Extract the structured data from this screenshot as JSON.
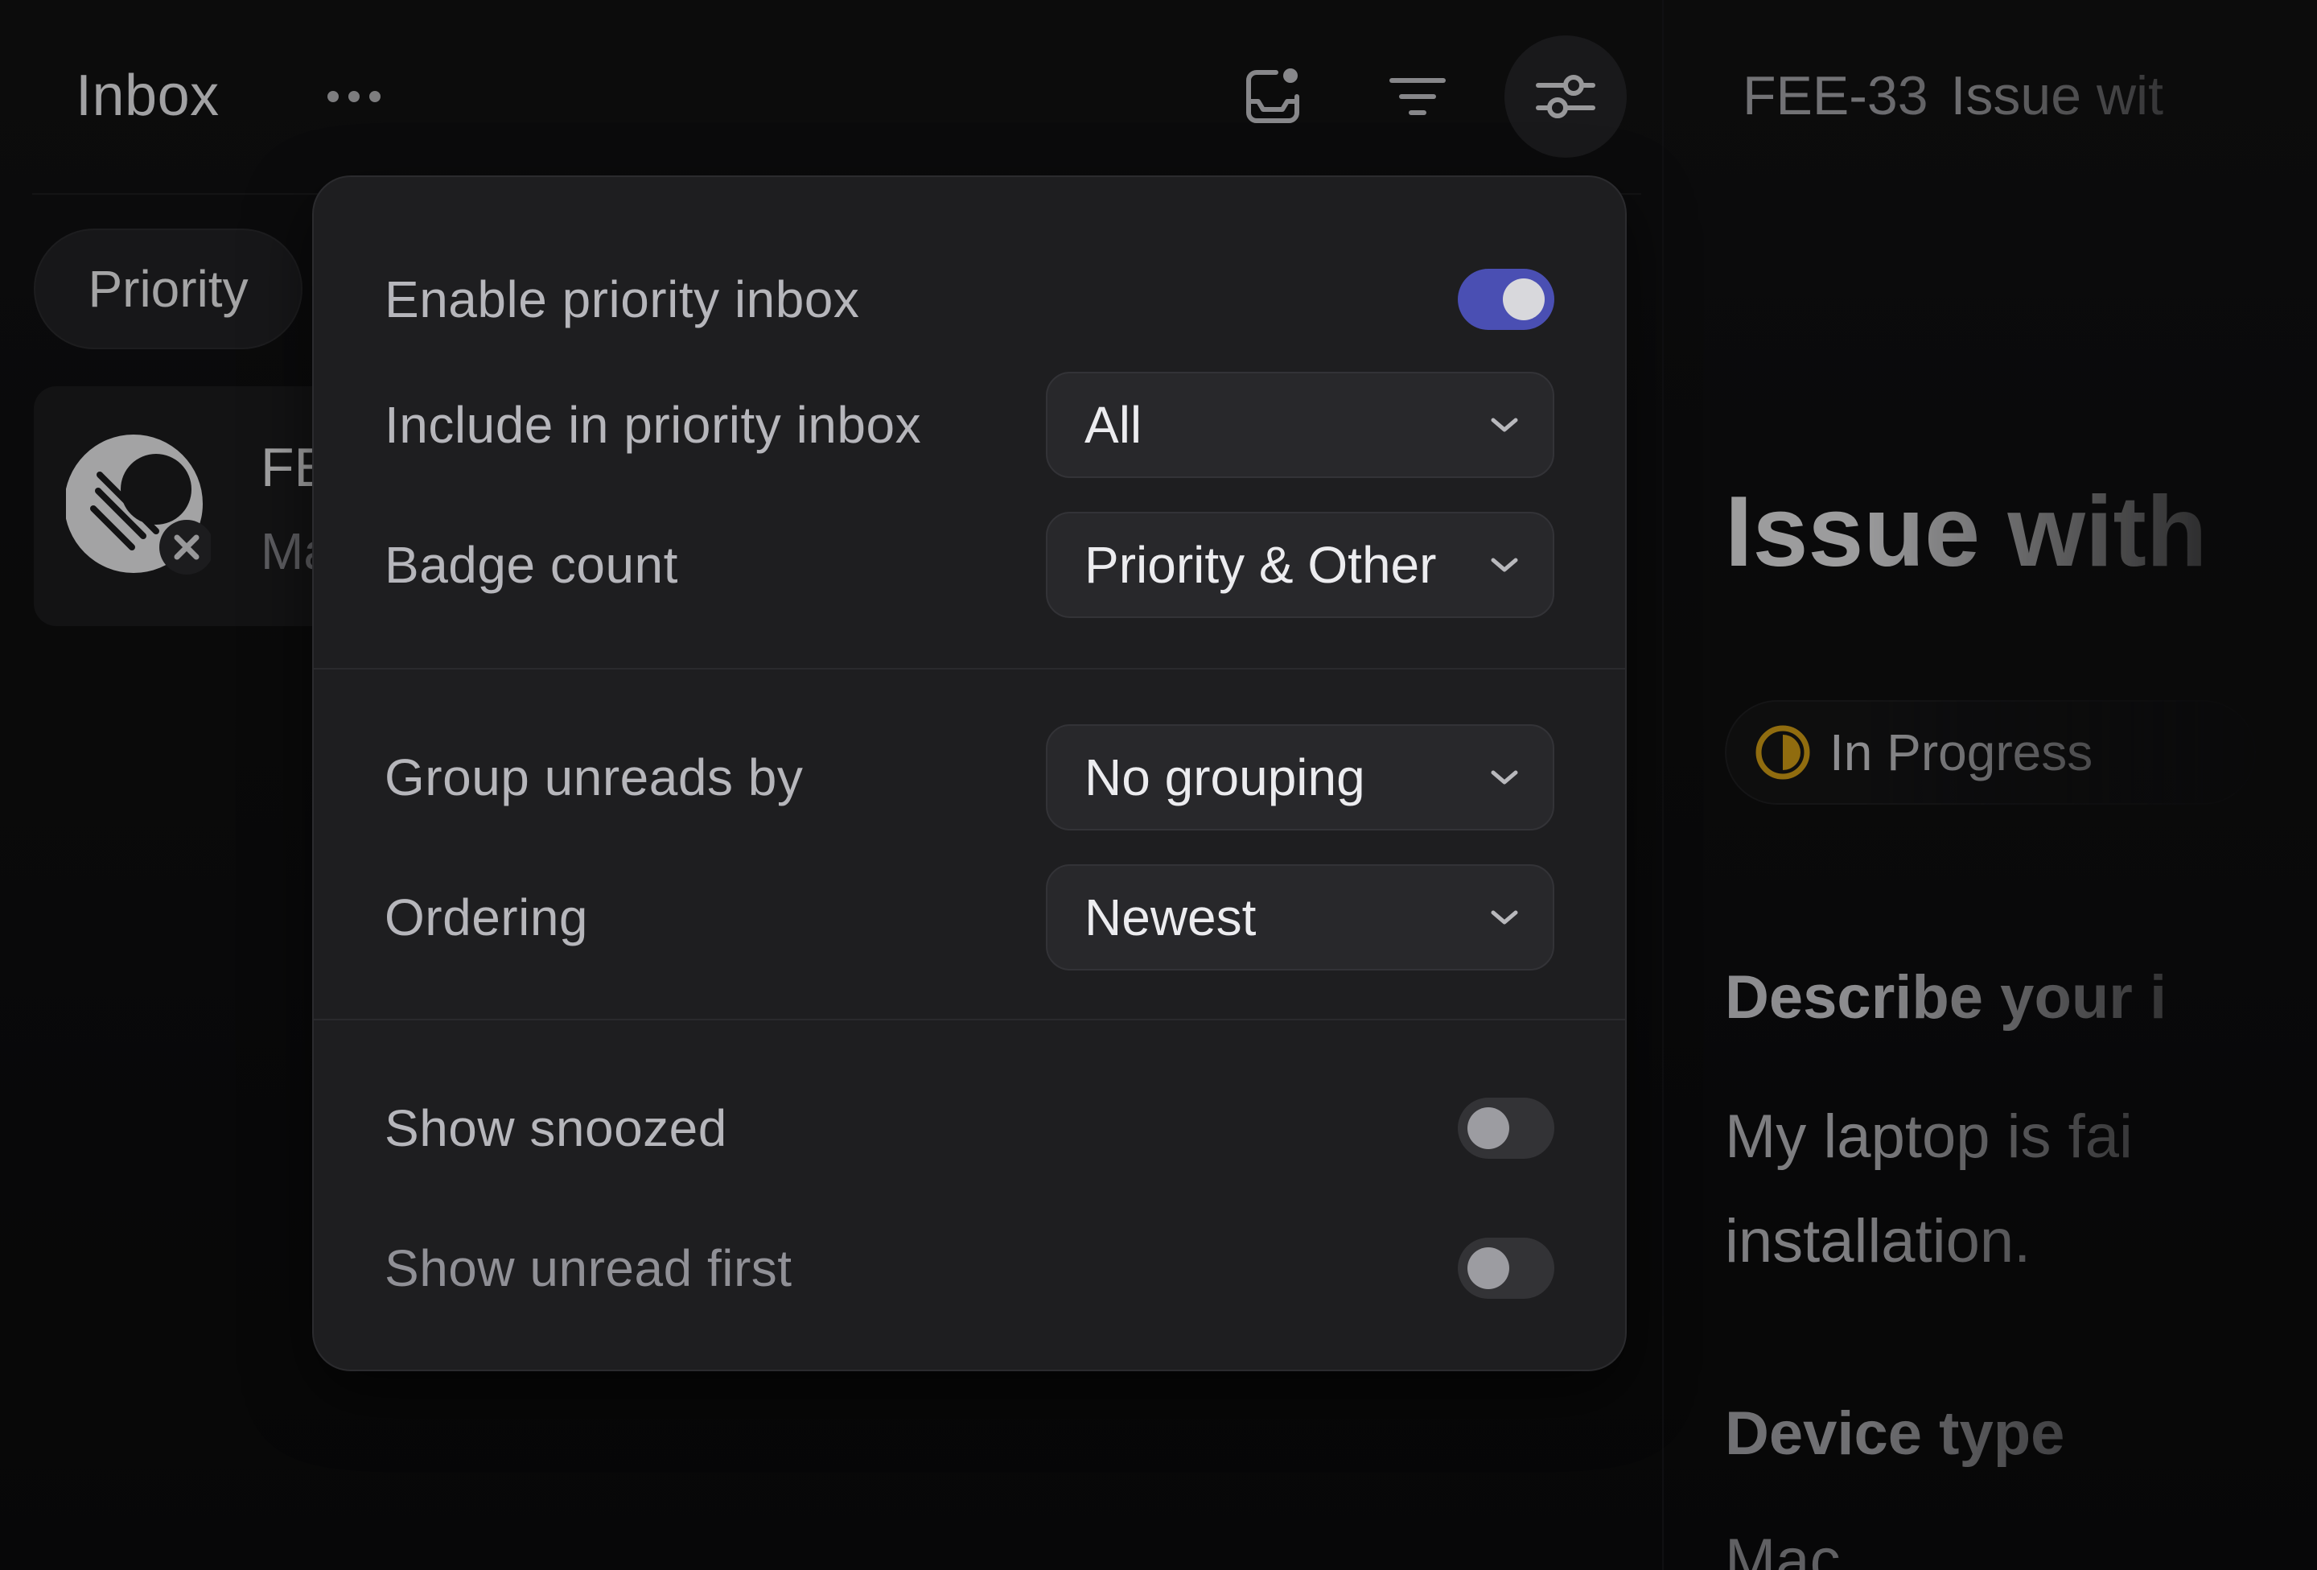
{
  "header": {
    "title": "Inbox",
    "more_icon": "more-horizontal-icon",
    "snooze_icon": "snooze-inbox-icon",
    "filter_icon": "filter-icon",
    "display_options_icon": "sliders-icon"
  },
  "filters": {
    "priority_label": "Priority"
  },
  "inbox_item": {
    "title_fragment": "FE",
    "subtitle_fragment": "Ma"
  },
  "detail": {
    "issue_id": "FEE-33",
    "issue_title_fragment": "Issue wit",
    "heading_fragment": "Issue with",
    "status": "In Progress",
    "status_color": "#d4a017",
    "describe_heading": "Describe your i",
    "describe_line1": "My laptop is fai",
    "describe_line2": "installation.",
    "device_heading": "Device type",
    "device_value": "Mac"
  },
  "settings": {
    "enable_priority_inbox": {
      "label": "Enable priority inbox",
      "checked": true
    },
    "include_in_priority": {
      "label": "Include in priority inbox",
      "value": "All"
    },
    "badge_count": {
      "label": "Badge count",
      "value": "Priority & Other"
    },
    "group_unreads_by": {
      "label": "Group unreads by",
      "value": "No grouping"
    },
    "ordering": {
      "label": "Ordering",
      "value": "Newest"
    },
    "show_snoozed": {
      "label": "Show snoozed",
      "checked": false
    },
    "show_unread_first": {
      "label": "Show unread first",
      "checked": false
    },
    "toggle_on_color": "#4a4fb3"
  }
}
